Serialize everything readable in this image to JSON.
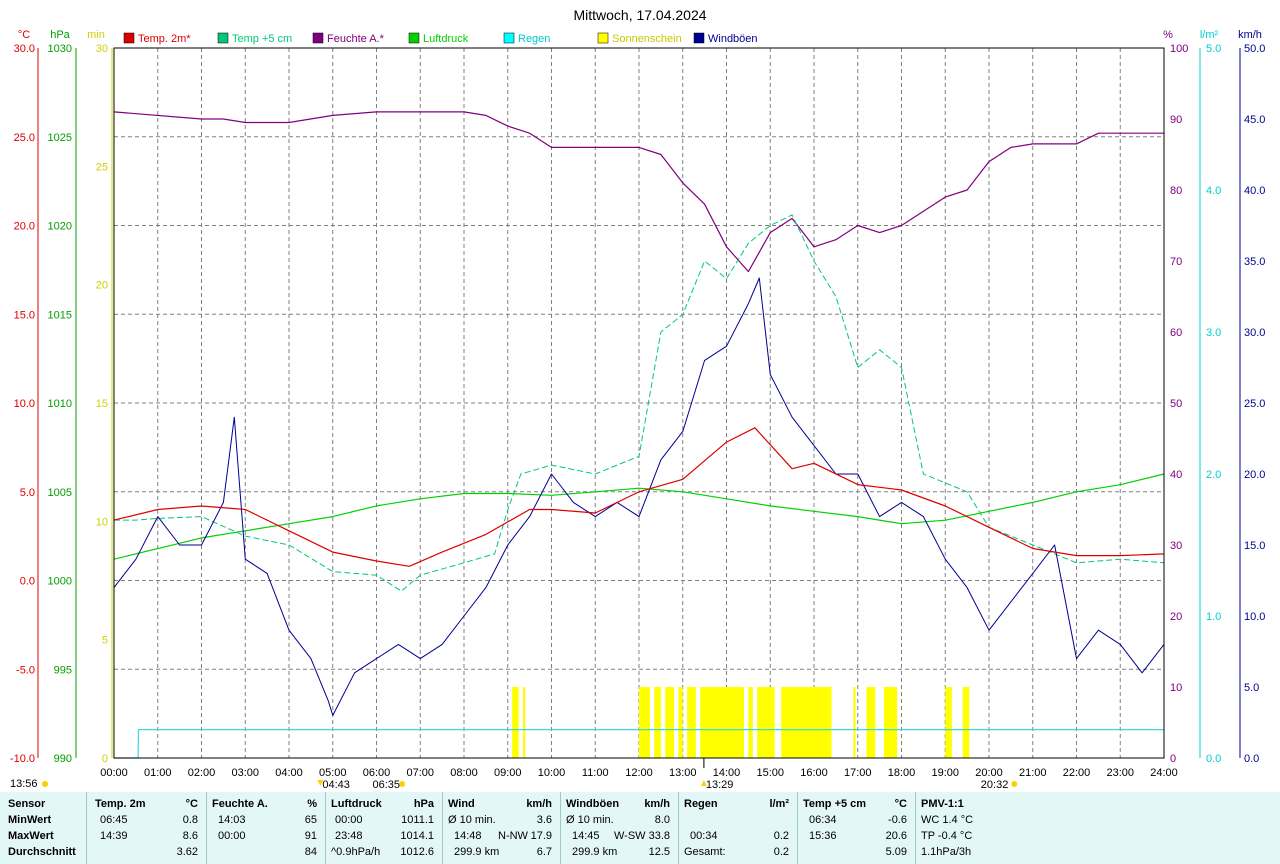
{
  "title": "Mittwoch, 17.04.2024",
  "colors": {
    "temp2m": "#dd0000",
    "temp5cm": "#00c878",
    "humidity": "#800080",
    "pressure": "#00d000",
    "rain": "#00ffff",
    "sunshine": "#ffff00",
    "gusts": "#000090",
    "rain_line": "#40d8d8"
  },
  "left_units": {
    "temp": "°C",
    "pressure": "hPa",
    "minutes": "min"
  },
  "right_units": {
    "humidity": "%",
    "rain": "l/m²",
    "wind": "km/h"
  },
  "legend": [
    {
      "label": "Temp. 2m*",
      "color": "#dd0000"
    },
    {
      "label": "Temp +5 cm",
      "color": "#00c878"
    },
    {
      "label": "Feuchte A.*",
      "color": "#800080"
    },
    {
      "label": "Luftdruck",
      "color": "#00d000"
    },
    {
      "label": "Regen",
      "color": "#00ffff"
    },
    {
      "label": "Sonnenschein",
      "color": "#ffff00"
    },
    {
      "label": "Windböen",
      "color": "#000090"
    }
  ],
  "time_markers": {
    "sunrise": "04:43",
    "dawn": "06:35",
    "noon": "13:29",
    "sunset": "20:32"
  },
  "footer_time": "13:56",
  "chart_data": {
    "type": "line",
    "x_unit": "hours",
    "xlim": [
      0,
      24
    ],
    "x_ticks": [
      "00:00",
      "01:00",
      "02:00",
      "03:00",
      "04:00",
      "05:00",
      "06:00",
      "07:00",
      "08:00",
      "09:00",
      "10:00",
      "11:00",
      "12:00",
      "13:00",
      "14:00",
      "15:00",
      "16:00",
      "17:00",
      "18:00",
      "19:00",
      "20:00",
      "21:00",
      "22:00",
      "23:00",
      "24:00"
    ],
    "axes": {
      "temp": {
        "range": [
          -10,
          30
        ],
        "ticks": [
          "30.0",
          "25.0",
          "20.0",
          "15.0",
          "10.0",
          "5.0",
          "0.0",
          "-5.0",
          "-10.0"
        ]
      },
      "pressure": {
        "range": [
          990,
          1030
        ],
        "ticks": [
          "1030",
          "1025",
          "1020",
          "1015",
          "1010",
          "1005",
          "1000",
          "995",
          "990"
        ]
      },
      "minutes": {
        "range": [
          0,
          30
        ],
        "ticks": [
          "30",
          "25",
          "20",
          "15",
          "10",
          "5",
          "0"
        ]
      },
      "humidity": {
        "range": [
          0,
          100
        ],
        "ticks": [
          "100",
          "90",
          "80",
          "70",
          "60",
          "50",
          "40",
          "30",
          "20",
          "10",
          "0"
        ]
      },
      "rain": {
        "range": [
          0,
          5
        ],
        "ticks": [
          "5.0",
          "4.0",
          "3.0",
          "2.0",
          "1.0",
          "0.0"
        ]
      },
      "wind": {
        "range": [
          0,
          50
        ],
        "ticks": [
          "50.0",
          "45.0",
          "40.0",
          "35.0",
          "30.0",
          "25.0",
          "20.0",
          "15.0",
          "10.0",
          "5.0",
          "0.0"
        ]
      }
    },
    "series": [
      {
        "name": "Temp. 2m*",
        "axis": "temp",
        "x": [
          0,
          1,
          2,
          3,
          4,
          5,
          6,
          6.75,
          7.5,
          8.5,
          9.5,
          10,
          11,
          12,
          13,
          14,
          14.65,
          15.5,
          16,
          17,
          18,
          19,
          20,
          21,
          22,
          23,
          24
        ],
        "y": [
          3.4,
          4,
          4.2,
          4,
          2.8,
          1.6,
          1.1,
          0.8,
          1.6,
          2.6,
          4,
          4,
          3.8,
          5,
          5.7,
          7.8,
          8.6,
          6.3,
          6.6,
          5.4,
          5.1,
          4.2,
          3,
          1.8,
          1.4,
          1.4,
          1.5
        ]
      },
      {
        "name": "Temp +5 cm",
        "axis": "temp",
        "x": [
          0,
          0.5,
          1,
          2,
          3,
          4,
          5,
          6,
          6.57,
          7,
          8,
          8.7,
          9,
          9.3,
          10,
          11,
          11.5,
          12,
          12.5,
          13,
          13.5,
          14,
          14.5,
          15,
          15.5,
          16,
          16.5,
          17,
          17.5,
          18,
          18.5,
          19,
          19.5,
          20,
          20.5,
          21,
          22,
          23,
          24
        ],
        "y": [
          3.4,
          3.4,
          3.5,
          3.6,
          2.5,
          2,
          0.5,
          0.3,
          -0.6,
          0.3,
          1,
          1.5,
          4,
          6,
          6.5,
          6,
          6.5,
          7,
          14,
          15,
          18,
          17,
          19,
          20,
          20.6,
          18,
          16,
          12,
          13,
          12,
          6,
          5.5,
          5,
          3,
          2.5,
          2,
          1,
          1.2,
          1
        ]
      },
      {
        "name": "Feuchte A.*",
        "axis": "humidity",
        "x": [
          0,
          2,
          2.5,
          3,
          4,
          5,
          6,
          7,
          8,
          8.5,
          9,
          9.5,
          10,
          11,
          12,
          12.5,
          13,
          13.5,
          14,
          14.5,
          15,
          15.5,
          16,
          16.5,
          17,
          17.5,
          18,
          18.5,
          19,
          19.5,
          20,
          20.5,
          21,
          21.5,
          22,
          22.5,
          23,
          24
        ],
        "y": [
          91,
          90,
          90,
          89.5,
          89.5,
          90.5,
          91,
          91,
          91,
          90.5,
          89,
          88,
          86,
          86,
          86,
          85,
          81,
          78,
          72,
          68.5,
          74,
          76,
          72,
          73,
          75,
          74,
          75,
          77,
          79,
          80,
          84,
          86,
          86.5,
          86.5,
          86.5,
          88,
          88,
          88
        ]
      },
      {
        "name": "Luftdruck",
        "axis": "pressure",
        "x": [
          0,
          1,
          2,
          3,
          4,
          5,
          6,
          7,
          8,
          9,
          10,
          11,
          12,
          13,
          14,
          15,
          16,
          17,
          18,
          19,
          20,
          21,
          22,
          23,
          24
        ],
        "y": [
          1001.2,
          1001.8,
          1002.4,
          1002.8,
          1003.2,
          1003.6,
          1004.2,
          1004.6,
          1004.9,
          1004.9,
          1004.8,
          1005,
          1005.2,
          1005,
          1004.6,
          1004.2,
          1003.9,
          1003.6,
          1003.2,
          1003.4,
          1003.9,
          1004.4,
          1005,
          1005.4,
          1006
        ]
      },
      {
        "name": "Regen",
        "axis": "rain",
        "x": [
          0,
          0.55,
          0.56,
          24
        ],
        "y": [
          0,
          0,
          0.2,
          0.2
        ]
      },
      {
        "name": "Windböen",
        "axis": "wind",
        "x": [
          0,
          0.5,
          1,
          1.5,
          2,
          2.5,
          2.75,
          3,
          3.5,
          4,
          4.5,
          4.9,
          5,
          5.5,
          6,
          6.5,
          7,
          7.5,
          8,
          8.5,
          9,
          9.5,
          10,
          10.5,
          11,
          11.5,
          12,
          12.5,
          13,
          13.5,
          14,
          14.5,
          14.75,
          15,
          15.5,
          16,
          16.5,
          17,
          17.5,
          18,
          18.5,
          19,
          19.5,
          20,
          20.5,
          21,
          21.5,
          22,
          22.5,
          23,
          23.5,
          24
        ],
        "y": [
          12,
          14,
          17,
          15,
          15,
          18,
          24,
          14,
          13,
          9,
          7,
          4,
          3,
          6,
          7,
          8,
          7,
          8,
          10,
          12,
          15,
          17,
          20,
          18,
          17,
          18,
          17,
          21,
          23,
          28,
          29,
          32,
          33.8,
          27,
          24,
          22,
          20,
          20,
          17,
          18,
          17,
          14,
          12,
          9,
          11,
          13,
          15,
          7,
          9,
          8,
          6,
          8
        ]
      }
    ],
    "sunshine_intervals": [
      [
        9.1,
        9.25
      ],
      [
        9.35,
        9.4
      ],
      [
        12.0,
        12.25
      ],
      [
        12.35,
        12.5
      ],
      [
        12.6,
        12.8
      ],
      [
        12.9,
        13.0
      ],
      [
        13.1,
        13.3
      ],
      [
        13.4,
        14.4
      ],
      [
        14.5,
        14.6
      ],
      [
        14.7,
        15.1
      ],
      [
        15.25,
        16.4
      ],
      [
        16.9,
        16.95
      ],
      [
        17.2,
        17.4
      ],
      [
        17.6,
        17.9
      ],
      [
        19.0,
        19.15
      ],
      [
        19.4,
        19.55
      ]
    ],
    "sunshine_axis": "humidity",
    "sunshine_bar_height": 10
  },
  "stats": {
    "row_labels": [
      "Sensor",
      "MinWert",
      "MaxWert",
      "Durchschnitt"
    ],
    "temp2m": {
      "title": "Temp. 2m",
      "unit": "°C",
      "min_time": "06:45",
      "min": "0.8",
      "max_time": "14:39",
      "max": "8.6",
      "avg": "3.62"
    },
    "humidity": {
      "title": "Feuchte A.",
      "unit": "%",
      "min_time": "14:03",
      "min": "65",
      "max_time": "00:00",
      "max": "91",
      "avg": "84"
    },
    "pressure": {
      "title": "Luftdruck",
      "unit": "hPa",
      "min_time": "00:00",
      "min": "1011.1",
      "max_time": "23:48",
      "max": "1014.1",
      "trend": "^0.9hPa/h",
      "avg": "1012.6"
    },
    "wind": {
      "title": "Wind",
      "unit": "km/h",
      "min_label": "Ø 10 min.",
      "min": "3.6",
      "max_time": "14:48",
      "max_dir": "N-NW",
      "max": "17.9",
      "dist": "299.9 km",
      "avg": "6.7"
    },
    "gusts": {
      "title": "Windböen",
      "unit": "km/h",
      "min_label": "Ø 10 min.",
      "min": "8.0",
      "max_time": "14:45",
      "max_dir": "W-SW",
      "max": "33.8",
      "dist": "299.9 km",
      "avg": "12.5"
    },
    "rain": {
      "title": "Regen",
      "unit": "l/m²",
      "max_time": "00:34",
      "max": "0.2",
      "total_label": "Gesamt:",
      "total": "0.2"
    },
    "temp5cm": {
      "title": "Temp +5 cm",
      "unit": "°C",
      "min_time": "06:34",
      "min": "-0.6",
      "max_time": "15:36",
      "max": "20.6",
      "avg": "5.09"
    },
    "pmv": {
      "title": "PMV-1:1",
      "wc": "WC 1.4 °C",
      "tp": "TP -0.4 °C",
      "trend": "1.1hPa/3h"
    }
  }
}
